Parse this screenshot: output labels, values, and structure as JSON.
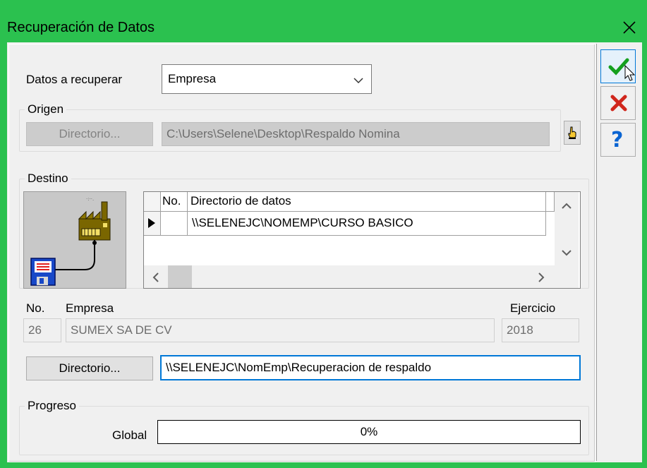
{
  "window": {
    "title": "Recuperación de Datos"
  },
  "datos": {
    "label": "Datos a recuperar",
    "value": "Empresa"
  },
  "origen": {
    "group_label": "Origen",
    "dir_button": "Directorio...",
    "path": "C:\\Users\\Selene\\Desktop\\Respaldo Nomina"
  },
  "destino": {
    "group_label": "Destino",
    "grid": {
      "col_no": "No.",
      "col_dir": "Directorio de datos",
      "row_path": "\\\\SELENEJC\\NOMEMP\\CURSO BASICO"
    },
    "no_label": "No.",
    "empresa_label": "Empresa",
    "ejercicio_label": "Ejercicio",
    "no_value": "26",
    "empresa_value": "SUMEX SA DE CV",
    "ejercicio_value": "2018",
    "dir_button": "Directorio...",
    "dir_path": "\\\\SELENEJC\\NomEmp\\Recuperacion de respaldo"
  },
  "progreso": {
    "group_label": "Progreso",
    "global_label": "Global",
    "global_value": "0%"
  },
  "colors": {
    "titlebar": "#2bc14f",
    "accept": "#14a01e",
    "cancel": "#d0261c",
    "help": "#0a64d2"
  }
}
